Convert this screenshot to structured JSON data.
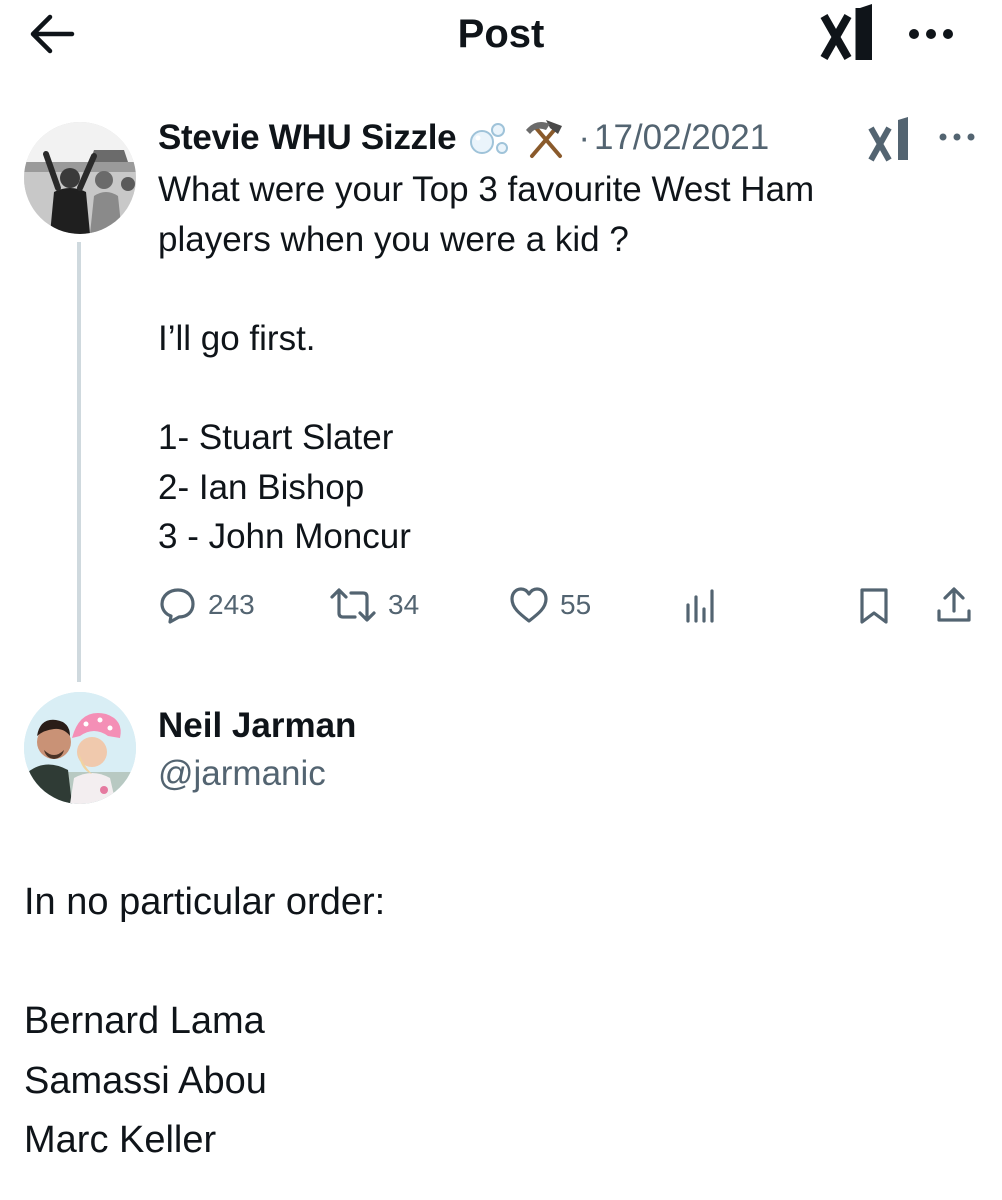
{
  "header": {
    "title": "Post",
    "back_icon": "arrow-left-icon",
    "grok_icon": "grok-icon",
    "more_icon": "more-horizontal-icon"
  },
  "parent_tweet": {
    "display_name": "Stevie WHU Sizzle",
    "badges": [
      "bubbles-emoji",
      "hammer-and-pick-emoji"
    ],
    "separator": "·",
    "date": "17/02/2021",
    "text": "What were your Top 3 favourite West Ham\nplayers when you were a kid ?\n\nI’ll go first.\n\n1- Stuart Slater\n2- Ian Bishop\n3 - John Moncur",
    "actions": {
      "replies": "243",
      "retweets": "34",
      "likes": "55"
    }
  },
  "reply_tweet": {
    "display_name": "Neil Jarman",
    "handle": "@jarmanic",
    "text": "In no particular order:\n\nBernard Lama\nSamassi Abou\nMarc Keller"
  },
  "colors": {
    "text_primary": "#0f1419",
    "text_secondary": "#536471",
    "thread_line": "#cfd9de"
  }
}
